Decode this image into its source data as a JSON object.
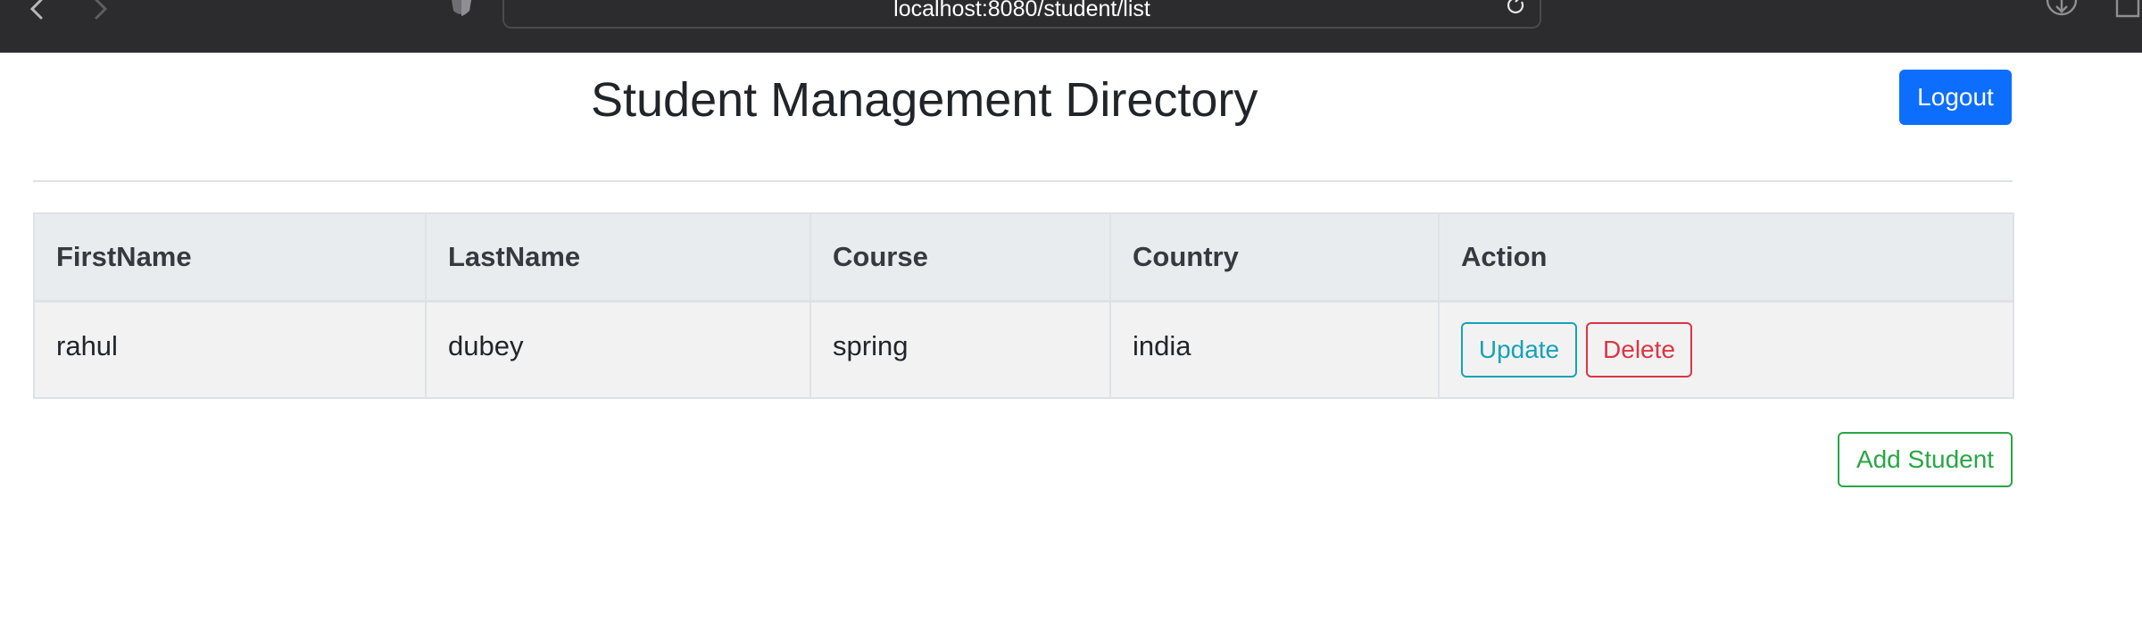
{
  "browser": {
    "url": "localhost:8080/student/list"
  },
  "page": {
    "title": "Student Management Directory",
    "logout_label": "Logout",
    "add_student_label": "Add Student"
  },
  "table": {
    "headers": [
      "FirstName",
      "LastName",
      "Course",
      "Country",
      "Action"
    ],
    "rows": [
      {
        "first_name": "rahul",
        "last_name": "dubey",
        "course": "spring",
        "country": "india",
        "update_label": "Update",
        "delete_label": "Delete"
      }
    ]
  },
  "colors": {
    "primary": "#0d6efd",
    "info": "#17a2b8",
    "danger": "#dc3545",
    "success": "#28a745"
  },
  "icons": [
    "back-icon",
    "forward-icon",
    "shield-icon",
    "reload-icon",
    "download-icon",
    "share-icon"
  ]
}
